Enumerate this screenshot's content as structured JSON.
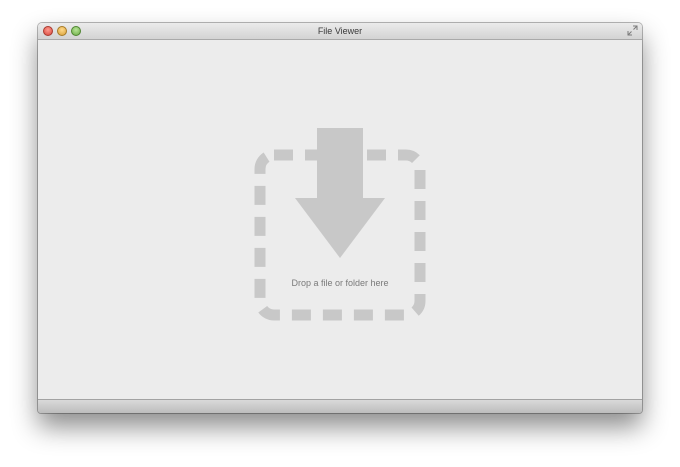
{
  "window": {
    "title": "File Viewer"
  },
  "dropzone": {
    "label": "Drop a file or folder here"
  },
  "icons": {
    "close": "close-button",
    "minimize": "minimize-button",
    "zoom": "zoom-button",
    "fullscreen": "fullscreen-arrows-icon",
    "drop": "download-arrow-icon"
  },
  "colors": {
    "background": "#ececec",
    "dropzone_graphic": "#c8c8c8",
    "label": "#7a7a7a"
  }
}
